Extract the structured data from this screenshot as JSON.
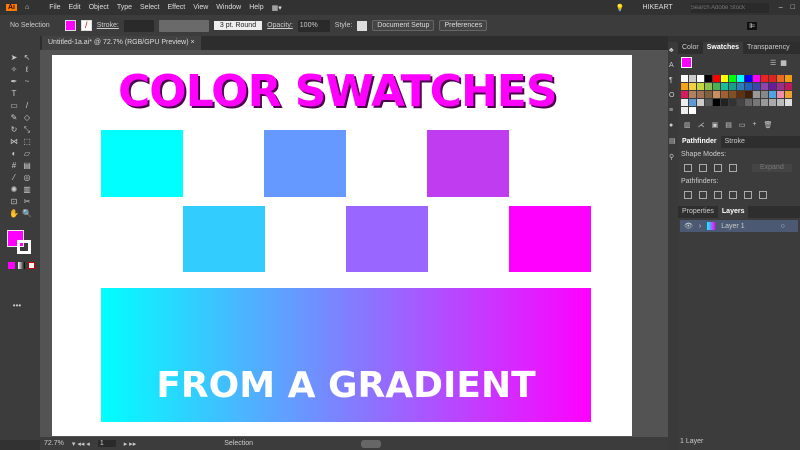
{
  "app": {
    "logo": "Ai",
    "menu": [
      "File",
      "Edit",
      "Object",
      "Type",
      "Select",
      "Effect",
      "View",
      "Window",
      "Help"
    ],
    "user": "HIKEART",
    "search_placeholder": "Search Adobe Stock"
  },
  "control": {
    "selection": "No Selection",
    "stroke_label": "Stroke:",
    "brush": "3 pt. Round",
    "opacity_label": "Opacity:",
    "opacity": "100%",
    "style_label": "Style:",
    "doc_setup": "Document Setup",
    "preferences": "Preferences",
    "fill_color": "#ff00ff"
  },
  "document": {
    "tab": "Untitled-1a.ai* @ 72.7% (RGB/GPU Preview)",
    "close": "×"
  },
  "artwork": {
    "title": "COLOR SWATCHES",
    "gradient_text": "FROM A GRADIENT",
    "gradient": [
      "#00ffff",
      "#ff00ff"
    ],
    "row1": [
      "#00ffff",
      "#6699ff",
      "#c03cf0"
    ],
    "row2": [
      "#33ccff",
      "#9966ff",
      "#ff00ff"
    ]
  },
  "status": {
    "zoom": "72.7%",
    "artboard": "1",
    "tool": "Selection"
  },
  "panels": {
    "tabs": [
      "Color",
      "Swatches",
      "Transparency"
    ],
    "pathfinder_tabs": [
      "Pathfinder",
      "Stroke"
    ],
    "shape_modes": "Shape Modes:",
    "expand": "Expand",
    "pathfinders": "Pathfinders:",
    "layer_tabs": [
      "Properties",
      "Layers"
    ],
    "layer": "Layer 1",
    "layer_count": "1 Layer",
    "swatches": [
      "#ffffff",
      "#cccccc",
      "#ffffff",
      "#000000",
      "#ff0000",
      "#ffff00",
      "#00ff00",
      "#00ffff",
      "#0000ff",
      "#ff00ff",
      "#ee2222",
      "#dd2222",
      "#ee6622",
      "#f39c12",
      "#f7a21b",
      "#f4d03f",
      "#c5d93a",
      "#8bc34a",
      "#4caf50",
      "#1abc9c",
      "#16a085",
      "#2980b9",
      "#1f5fbf",
      "#3949ab",
      "#8e44ad",
      "#6a1b9a",
      "#9b2d8f",
      "#c2185b",
      "#d81b60",
      "#b08060",
      "#a07050",
      "#806040",
      "#c89060",
      "#a06030",
      "#805020",
      "#603010",
      "#402008",
      "#999999",
      "#888888",
      "#4fa3e0",
      "#f08bb0",
      "#f0a030",
      "#eeeeee",
      "#5c9bd5",
      "#cccccc",
      "#555555",
      "#000000",
      "#222222",
      "#333333",
      "#444444",
      "#666666",
      "#777777",
      "#999999",
      "#aaaaaa",
      "#bbbbbb",
      "#dddddd",
      "#eeeeee",
      "#ffffff"
    ]
  }
}
